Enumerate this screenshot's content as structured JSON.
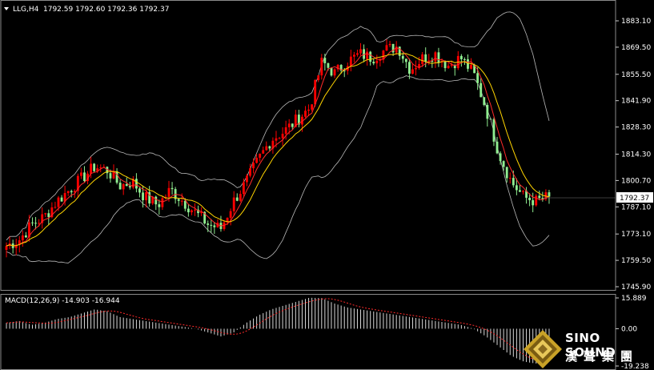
{
  "header": {
    "symbol": "LLG,H4",
    "ohlc": "1792.59 1792.60 1792.36 1792.37"
  },
  "macd": {
    "label": "MACD(12,26,9) -14.903 -16.944",
    "ticks": [
      "15.889",
      "0.00",
      "-19.238"
    ]
  },
  "logo": {
    "en": "SINO SOUND",
    "cn": "漢聲集團"
  },
  "chart_data": {
    "type": "candlestick",
    "price_axis": {
      "ticks": [
        "1883.10",
        "1869.50",
        "1855.50",
        "1841.90",
        "1828.30",
        "1814.30",
        "1800.70",
        "1787.10",
        "1773.10",
        "1759.50",
        "1745.90"
      ],
      "ylim": [
        1745.9,
        1883.1
      ]
    },
    "current_price": "1792.37",
    "overlays": [
      "Bollinger Bands (silver)",
      "Moving average (red)",
      "Moving average (yellow)"
    ],
    "price_path": [
      1767,
      1770,
      1778,
      1782,
      1790,
      1796,
      1802,
      1808,
      1806,
      1798,
      1800,
      1792,
      1788,
      1796,
      1790,
      1784,
      1778,
      1776,
      1790,
      1800,
      1812,
      1822,
      1826,
      1832,
      1838,
      1862,
      1856,
      1862,
      1866,
      1864,
      1868,
      1870,
      1858,
      1864,
      1866,
      1860,
      1864,
      1856,
      1838,
      1815,
      1800,
      1792,
      1790,
      1792.4
    ],
    "macd_hist": [
      3,
      4,
      2,
      3,
      5,
      6,
      8,
      10,
      9,
      6,
      5,
      4,
      3,
      2,
      1,
      0,
      -2,
      -4,
      -2,
      3,
      7,
      10,
      12,
      14,
      16,
      15.8,
      13,
      11,
      10,
      9,
      8,
      7,
      6,
      5,
      4,
      3,
      2,
      0,
      -4,
      -9,
      -14,
      -17,
      -18,
      -15
    ],
    "macd_ylim": [
      -19.238,
      15.889
    ]
  }
}
